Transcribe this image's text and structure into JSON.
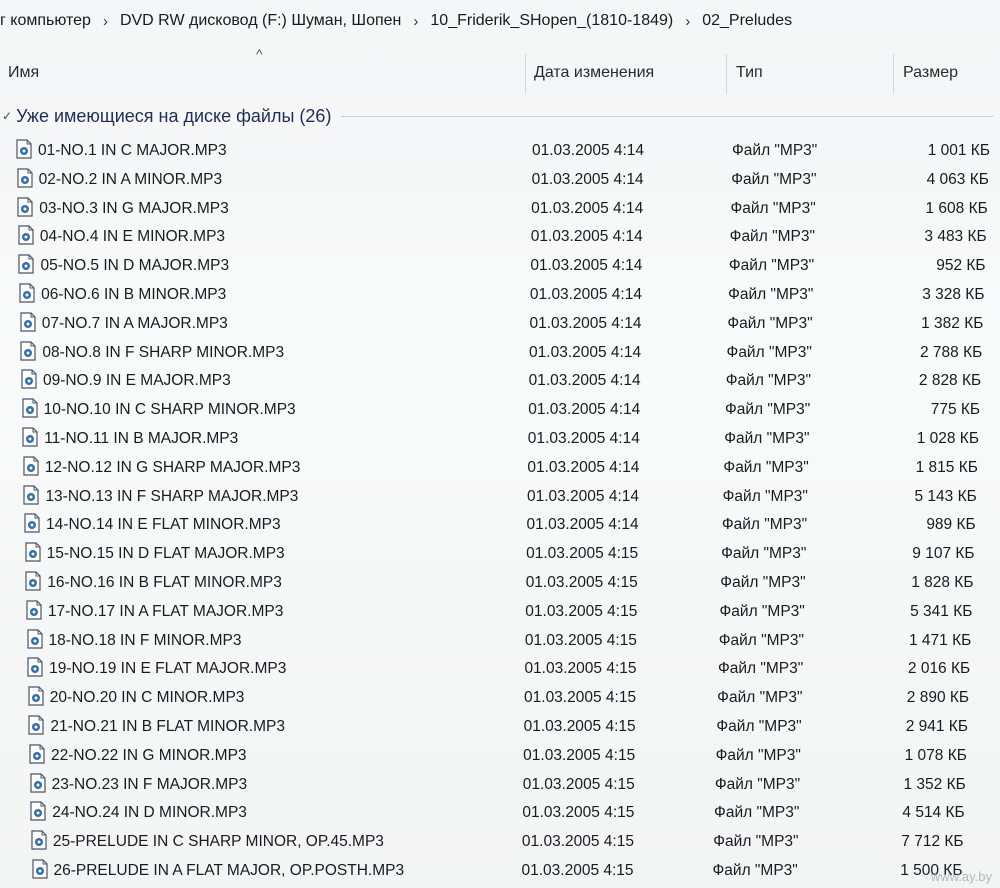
{
  "breadcrumb": {
    "items": [
      "г компьютер",
      "DVD RW дисковод (F:) Шуман, Шопен",
      "10_Friderik_SHopen_(1810-1849)",
      "02_Preludes"
    ],
    "separator": "›"
  },
  "columns": {
    "name": "Имя",
    "date": "Дата изменения",
    "type": "Тип",
    "size": "Размер",
    "sort_indicator": "^"
  },
  "group": {
    "label": "Уже имеющиеся на диске файлы (26)",
    "chevron": "✓"
  },
  "files": [
    {
      "name": "01-NO.1 IN C MAJOR.MP3",
      "date": "01.03.2005 4:14",
      "type": "Файл \"MP3\"",
      "size": "1 001 КБ"
    },
    {
      "name": "02-NO.2 IN A MINOR.MP3",
      "date": "01.03.2005 4:14",
      "type": "Файл \"MP3\"",
      "size": "4 063 КБ"
    },
    {
      "name": "03-NO.3 IN G MAJOR.MP3",
      "date": "01.03.2005 4:14",
      "type": "Файл \"MP3\"",
      "size": "1 608 КБ"
    },
    {
      "name": "04-NO.4 IN E MINOR.MP3",
      "date": "01.03.2005 4:14",
      "type": "Файл \"MP3\"",
      "size": "3 483 КБ"
    },
    {
      "name": "05-NO.5 IN D MAJOR.MP3",
      "date": "01.03.2005 4:14",
      "type": "Файл \"MP3\"",
      "size": "952 КБ"
    },
    {
      "name": "06-NO.6 IN B MINOR.MP3",
      "date": "01.03.2005 4:14",
      "type": "Файл \"MP3\"",
      "size": "3 328 КБ"
    },
    {
      "name": "07-NO.7 IN A MAJOR.MP3",
      "date": "01.03.2005 4:14",
      "type": "Файл \"MP3\"",
      "size": "1 382 КБ"
    },
    {
      "name": "08-NO.8 IN F SHARP MINOR.MP3",
      "date": "01.03.2005 4:14",
      "type": "Файл \"MP3\"",
      "size": "2 788 КБ"
    },
    {
      "name": "09-NO.9 IN E MAJOR.MP3",
      "date": "01.03.2005 4:14",
      "type": "Файл \"MP3\"",
      "size": "2 828 КБ"
    },
    {
      "name": "10-NO.10 IN C SHARP MINOR.MP3",
      "date": "01.03.2005 4:14",
      "type": "Файл \"MP3\"",
      "size": "775 КБ"
    },
    {
      "name": "11-NO.11 IN B MAJOR.MP3",
      "date": "01.03.2005 4:14",
      "type": "Файл \"MP3\"",
      "size": "1 028 КБ"
    },
    {
      "name": "12-NO.12 IN G SHARP MAJOR.MP3",
      "date": "01.03.2005 4:14",
      "type": "Файл \"MP3\"",
      "size": "1 815 КБ"
    },
    {
      "name": "13-NO.13 IN F SHARP MAJOR.MP3",
      "date": "01.03.2005 4:14",
      "type": "Файл \"MP3\"",
      "size": "5 143 КБ"
    },
    {
      "name": "14-NO.14 IN E FLAT MINOR.MP3",
      "date": "01.03.2005 4:14",
      "type": "Файл \"MP3\"",
      "size": "989 КБ"
    },
    {
      "name": "15-NO.15 IN D FLAT MAJOR.MP3",
      "date": "01.03.2005 4:15",
      "type": "Файл \"MP3\"",
      "size": "9 107 КБ"
    },
    {
      "name": "16-NO.16 IN B FLAT MINOR.MP3",
      "date": "01.03.2005 4:15",
      "type": "Файл \"MP3\"",
      "size": "1 828 КБ"
    },
    {
      "name": "17-NO.17 IN A FLAT MAJOR.MP3",
      "date": "01.03.2005 4:15",
      "type": "Файл \"MP3\"",
      "size": "5 341 КБ"
    },
    {
      "name": "18-NO.18 IN F MINOR.MP3",
      "date": "01.03.2005 4:15",
      "type": "Файл \"MP3\"",
      "size": "1 471 КБ"
    },
    {
      "name": "19-NO.19 IN E FLAT MAJOR.MP3",
      "date": "01.03.2005 4:15",
      "type": "Файл \"MP3\"",
      "size": "2 016 КБ"
    },
    {
      "name": "20-NO.20 IN C MINOR.MP3",
      "date": "01.03.2005 4:15",
      "type": "Файл \"MP3\"",
      "size": "2 890 КБ"
    },
    {
      "name": "21-NO.21 IN B FLAT MINOR.MP3",
      "date": "01.03.2005 4:15",
      "type": "Файл \"MP3\"",
      "size": "2 941 КБ"
    },
    {
      "name": "22-NO.22 IN G MINOR.MP3",
      "date": "01.03.2005 4:15",
      "type": "Файл \"MP3\"",
      "size": "1 078 КБ"
    },
    {
      "name": "23-NO.23 IN F MAJOR.MP3",
      "date": "01.03.2005 4:15",
      "type": "Файл \"MP3\"",
      "size": "1 352 КБ"
    },
    {
      "name": "24-NO.24 IN D MINOR.MP3",
      "date": "01.03.2005 4:15",
      "type": "Файл \"MP3\"",
      "size": "4 514 КБ"
    },
    {
      "name": "25-PRELUDE IN C SHARP MINOR, OP.45.MP3",
      "date": "01.03.2005 4:15",
      "type": "Файл \"MP3\"",
      "size": "7 712 КБ"
    },
    {
      "name": "26-PRELUDE IN A FLAT MAJOR, OP.POSTH.MP3",
      "date": "01.03.2005 4:15",
      "type": "Файл \"MP3\"",
      "size": "1 500 КБ"
    }
  ],
  "file_icon": "mp3-file-icon",
  "watermark": "www.ay.by"
}
